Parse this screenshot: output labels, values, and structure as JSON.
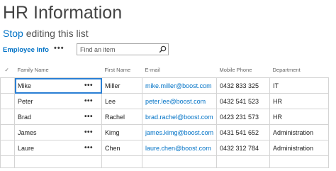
{
  "page": {
    "title": "HR Information",
    "stop_label": "Stop",
    "edit_rest": " editing this list"
  },
  "toolbar": {
    "view_label": "Employee Info",
    "more_label": "•••",
    "search": {
      "placeholder": "Find an item",
      "value": ""
    }
  },
  "icons": {
    "search": "search-icon",
    "check": "checkmark-icon",
    "more": "ellipsis-icon"
  },
  "colors": {
    "link": "#0072c6",
    "selected_cell_border": "#2a7fd4",
    "grid_line": "#d4d4d4"
  },
  "table": {
    "header_check": "✓",
    "columns": [
      "Family Name",
      "First Name",
      "E-mail",
      "Mobile Phone",
      "Department"
    ],
    "rows": [
      {
        "family": "Mike",
        "first": "Miller",
        "email": "mike.miller@boost.com",
        "phone": "0432 833 325",
        "dept": "IT"
      },
      {
        "family": "Peter",
        "first": "Lee",
        "email": "peter.lee@boost.com",
        "phone": "0432 541 523",
        "dept": "HR"
      },
      {
        "family": "Brad",
        "first": "Rachel",
        "email": "brad.rachel@boost.com",
        "phone": "0423 231 573",
        "dept": "HR"
      },
      {
        "family": "James",
        "first": "Kimg",
        "email": "james.kimg@boost.com",
        "phone": "0431 541 652",
        "dept": "Administration"
      },
      {
        "family": "Laure",
        "first": "Chen",
        "email": "laure.chen@boost.com",
        "phone": "0432 312 784",
        "dept": "Administration"
      }
    ],
    "row_menu": "•••"
  }
}
